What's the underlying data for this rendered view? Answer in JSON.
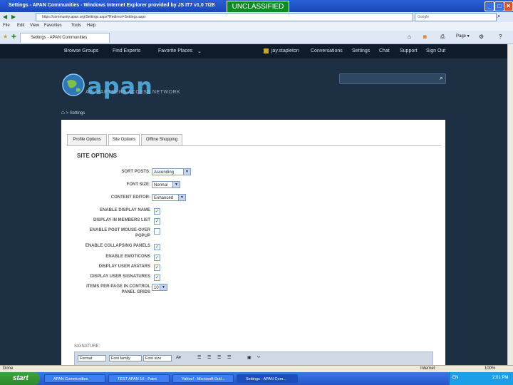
{
  "window": {
    "title": "Settings - APAN Communities - Windows Internet Explorer provided by JS IT7 v1.0 7/28",
    "classification": "UNCLASSIFIED"
  },
  "browser": {
    "address": "https://community.apan.org/Settings.aspx?Redirect=Settings.aspx",
    "search_placeholder": "Google",
    "menu": [
      "File",
      "Edit",
      "View",
      "Favorites",
      "Tools",
      "Help"
    ],
    "tab_label": "Settings - APAN Communities",
    "status_text": "Done",
    "zone": "Internet",
    "zoom": "100%"
  },
  "site_nav": {
    "left": [
      "Browse Groups",
      "Find Experts",
      "Favorite Places"
    ],
    "user": "jay.stapleton",
    "right": [
      "Conversations",
      "Settings",
      "Chat",
      "Support",
      "Sign Out"
    ]
  },
  "logo": {
    "word": "apan",
    "subtitle": "ALL PARTNERS ACCESS NETWORK"
  },
  "breadcrumb": {
    "separator": ">",
    "current": "Settings"
  },
  "tabs": [
    "Profile Options",
    "Site Options",
    "Offline Shopping"
  ],
  "section_title": "SITE OPTIONS",
  "options": {
    "sort_posts": {
      "label": "SORT POSTS:",
      "value": "Ascending"
    },
    "font_size": {
      "label": "FONT SIZE:",
      "value": "Normal"
    },
    "content_editor": {
      "label": "CONTENT EDITOR:",
      "value": "Enhanced"
    },
    "checkboxes": [
      {
        "label": "ENABLE DISPLAY NAME",
        "checked": true
      },
      {
        "label": "DISPLAY IN MEMBERS LIST",
        "checked": true
      },
      {
        "label": "ENABLE POST MOUSE-OVER POPUP",
        "checked": false
      },
      {
        "label": "ENABLE COLLAPSING PANELS",
        "checked": true
      },
      {
        "label": "ENABLE EMOTICONS",
        "checked": true
      },
      {
        "label": "DISPLAY USER AVATARS",
        "checked": true
      },
      {
        "label": "DISPLAY USER SIGNATURES",
        "checked": true
      }
    ],
    "items_per_page": {
      "label": "ITEMS PER-PAGE IN CONTROL PANEL GRIDS",
      "value": "10"
    }
  },
  "signature": {
    "label": "SIGNATURE:",
    "format": "Format",
    "font_family": "Font family",
    "font_size": "Font size"
  },
  "taskbar": {
    "start": "start",
    "tasks": [
      "APAN Communities",
      "TEST APAN 10 - Paint",
      "Yahoo! - Microsoft Outl...",
      "Settings - APAN Com..."
    ],
    "clock": "2:01 PM",
    "lang": "EN"
  },
  "colors": {
    "page_bg": "#1d2f43",
    "nav_bg": "#0f1b28",
    "classification": "#0f8a25"
  }
}
